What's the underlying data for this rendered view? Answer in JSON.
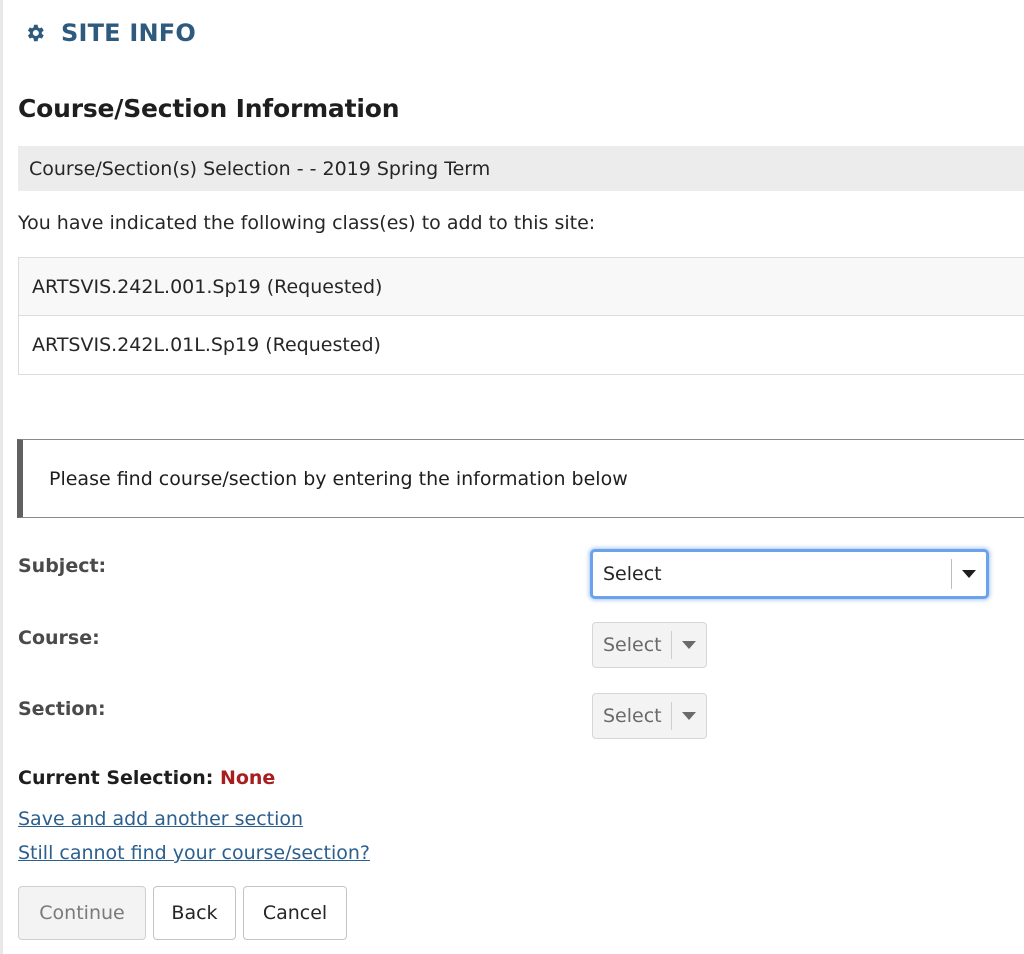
{
  "tool_header": {
    "icon": "gear-icon",
    "title": "SITE INFO",
    "accent_color": "#2e5a7e"
  },
  "page_title": "Course/Section Information",
  "term_bar": "Course/Section(s) Selection - - 2019 Spring Term",
  "intro_text": "You have indicated the following class(es) to add to this site:",
  "classes": [
    {
      "label": "ARTSVIS.242L.001.Sp19 (Requested)"
    },
    {
      "label": "ARTSVIS.242L.01L.Sp19 (Requested)"
    }
  ],
  "info_message": "Please find course/section by entering the information below",
  "form": {
    "subject": {
      "label": "Subject:",
      "value": "Select",
      "state": "focused"
    },
    "course": {
      "label": "Course:",
      "value": "Select",
      "state": "disabled"
    },
    "section": {
      "label": "Section:",
      "value": "Select",
      "state": "disabled"
    }
  },
  "current_selection": {
    "label": "Current Selection:",
    "value": "None",
    "value_color": "#a81e1e"
  },
  "links": {
    "save_add": "Save and add another section",
    "cannot_find": "Still cannot find your course/section?"
  },
  "buttons": {
    "continue": {
      "label": "Continue",
      "state": "disabled"
    },
    "back": {
      "label": "Back"
    },
    "cancel": {
      "label": "Cancel"
    }
  }
}
